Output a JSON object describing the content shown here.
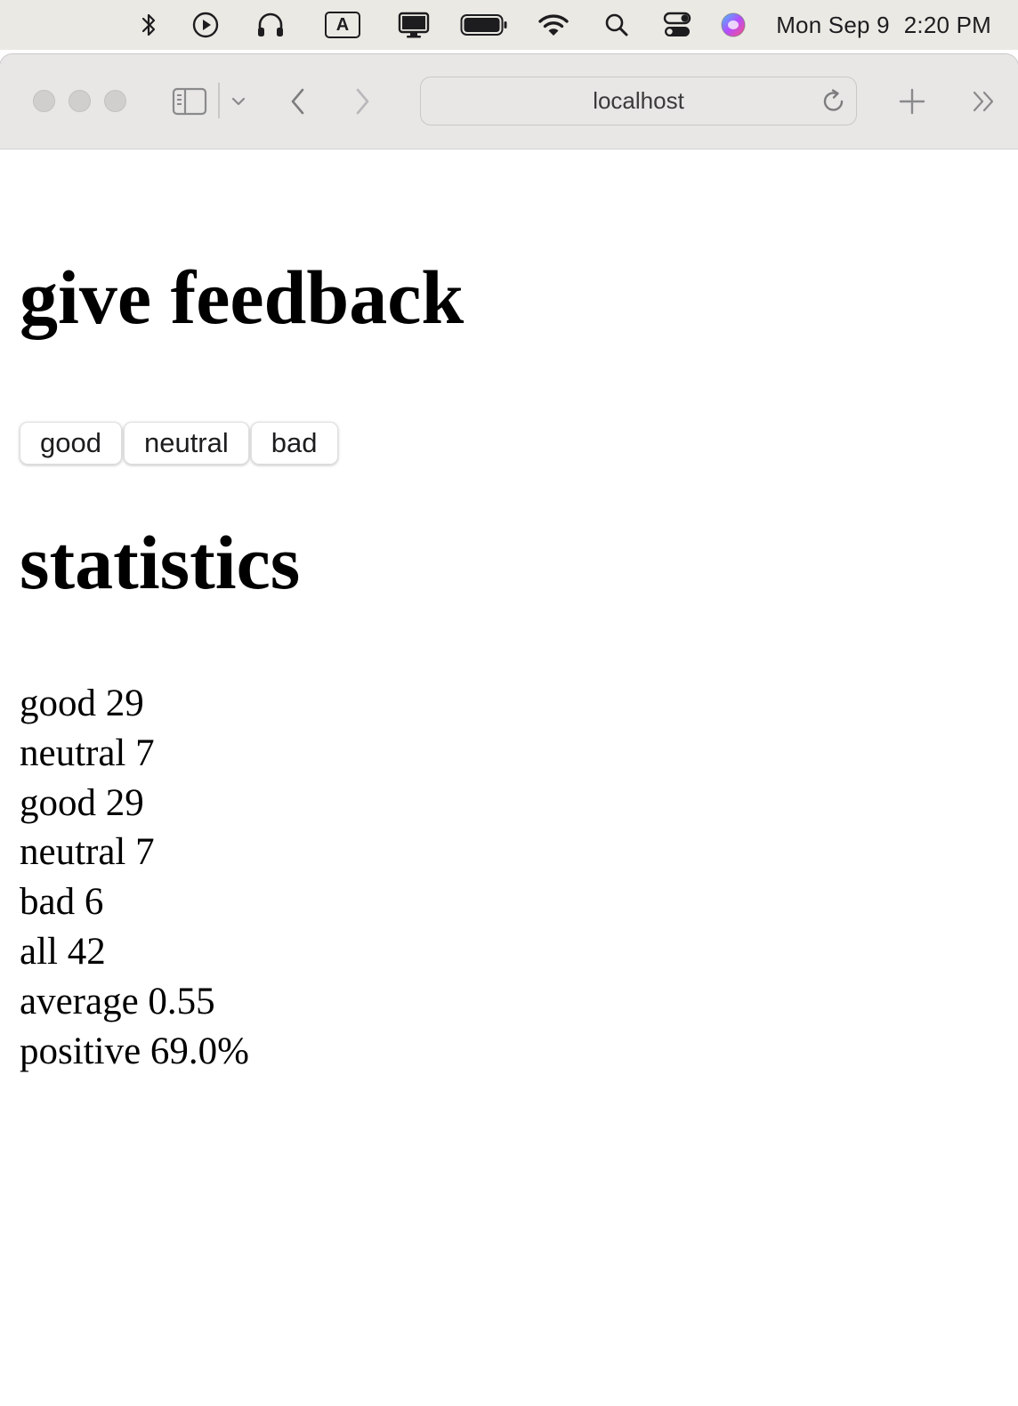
{
  "menubar": {
    "icons": [
      "bluetooth-icon",
      "play-circle-icon",
      "headphones-icon",
      "text-input-a-icon",
      "display-icon",
      "battery-icon",
      "wifi-icon",
      "search-icon",
      "control-center-icon",
      "siri-icon"
    ],
    "input_letter": "A",
    "date": "Mon Sep 9",
    "time": "2:20 PM"
  },
  "browser": {
    "address": "localhost",
    "icons": [
      "sidebar-icon",
      "chevron-down-icon",
      "back-icon",
      "forward-icon",
      "reload-icon",
      "new-tab-icon",
      "more-icon"
    ]
  },
  "page": {
    "feedback_title": "give feedback",
    "buttons": [
      {
        "label": "good"
      },
      {
        "label": "neutral"
      },
      {
        "label": "bad"
      }
    ],
    "statistics_title": "statistics",
    "stats": [
      "good 29",
      "neutral 7",
      "good 29",
      "neutral 7",
      "bad 6",
      "all 42",
      "average 0.55",
      "positive 69.0%"
    ]
  }
}
